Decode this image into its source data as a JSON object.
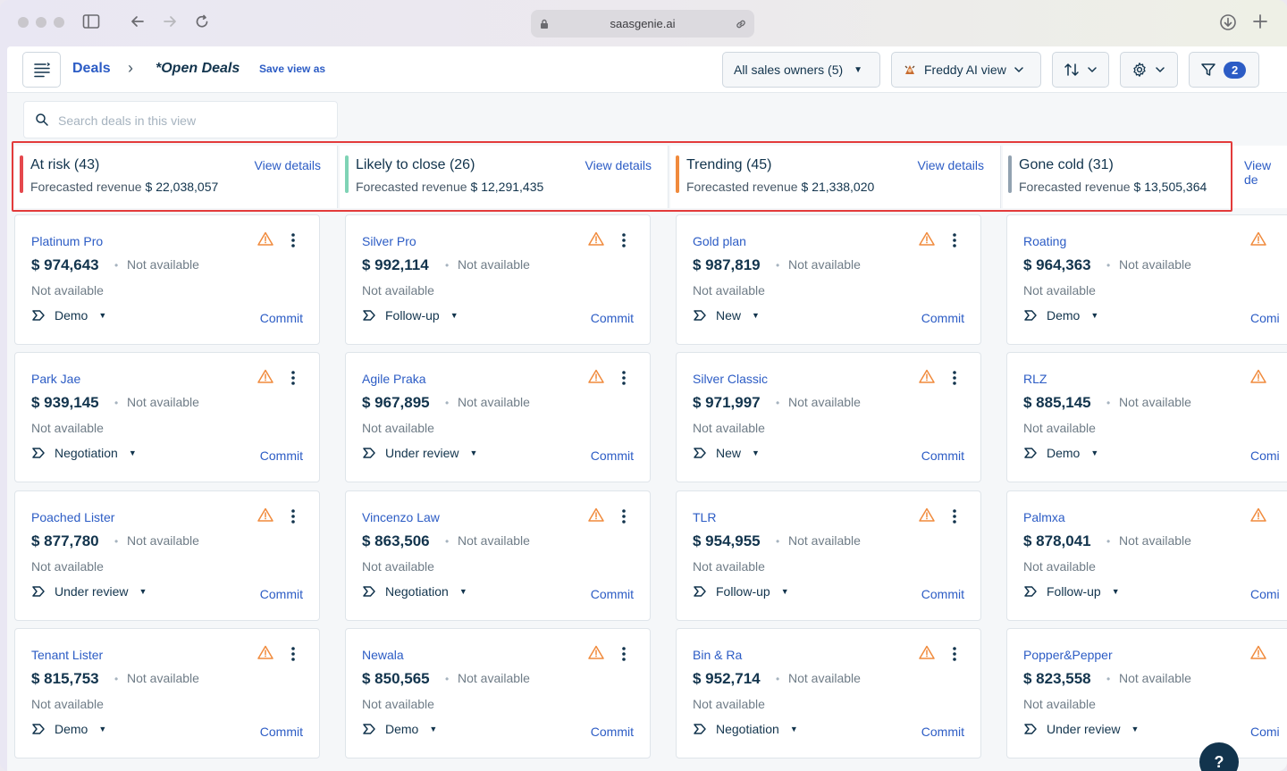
{
  "browser": {
    "url": "saasgenie.ai"
  },
  "header": {
    "breadcrumb_root": "Deals",
    "breadcrumb_sep": "›",
    "view_name": "*Open Deals",
    "save_view": "Save view as",
    "owners_filter": "All sales owners (5)",
    "ai_view": "Freddy AI view",
    "filter_count": "2"
  },
  "search": {
    "placeholder": "Search deals in this view"
  },
  "summaries": [
    {
      "title": "At risk (43)",
      "forecast_label": "Forecasted revenue",
      "revenue": "$ 22,038,057",
      "link": "View details",
      "color": "#e5484d"
    },
    {
      "title": "Likely to close (26)",
      "forecast_label": "Forecasted revenue",
      "revenue": "$ 12,291,435",
      "link": "View details",
      "color": "#7fd3b5"
    },
    {
      "title": "Trending (45)",
      "forecast_label": "Forecasted revenue",
      "revenue": "$ 21,338,020",
      "link": "View details",
      "color": "#f08a3c"
    },
    {
      "title": "Gone cold (31)",
      "forecast_label": "Forecasted revenue",
      "revenue": "$ 13,505,364",
      "link": "View de",
      "color": "#92a2b1"
    }
  ],
  "card_common": {
    "not_available": "Not available",
    "commit": "Commit",
    "commit_clipped": "Comi"
  },
  "columns": [
    [
      {
        "name": "Platinum Pro",
        "amount": "$ 974,643",
        "stage": "Demo"
      },
      {
        "name": "Park Jae",
        "amount": "$ 939,145",
        "stage": "Negotiation"
      },
      {
        "name": "Poached Lister",
        "amount": "$ 877,780",
        "stage": "Under review"
      },
      {
        "name": "Tenant Lister",
        "amount": "$ 815,753",
        "stage": "Demo"
      }
    ],
    [
      {
        "name": "Silver Pro",
        "amount": "$ 992,114",
        "stage": "Follow-up"
      },
      {
        "name": "Agile Praka",
        "amount": "$ 967,895",
        "stage": "Under review"
      },
      {
        "name": "Vincenzo Law",
        "amount": "$ 863,506",
        "stage": "Negotiation"
      },
      {
        "name": "Newala",
        "amount": "$ 850,565",
        "stage": "Demo"
      }
    ],
    [
      {
        "name": "Gold plan",
        "amount": "$ 987,819",
        "stage": "New"
      },
      {
        "name": "Silver Classic",
        "amount": "$ 971,997",
        "stage": "New"
      },
      {
        "name": "TLR",
        "amount": "$ 954,955",
        "stage": "Follow-up"
      },
      {
        "name": "Bin & Ra",
        "amount": "$ 952,714",
        "stage": "Negotiation"
      }
    ],
    [
      {
        "name": "Roating",
        "amount": "$ 964,363",
        "stage": "Demo"
      },
      {
        "name": "RLZ",
        "amount": "$ 885,145",
        "stage": "Demo"
      },
      {
        "name": "Palmxa",
        "amount": "$ 878,041",
        "stage": "Follow-up"
      },
      {
        "name": "Popper&Pepper",
        "amount": "$ 823,558",
        "stage": "Under review"
      }
    ]
  ],
  "help": "?",
  "colors": {
    "accent": "#2c5cc5",
    "warning": "#f08a3c",
    "highlight": "#e33b3b"
  }
}
